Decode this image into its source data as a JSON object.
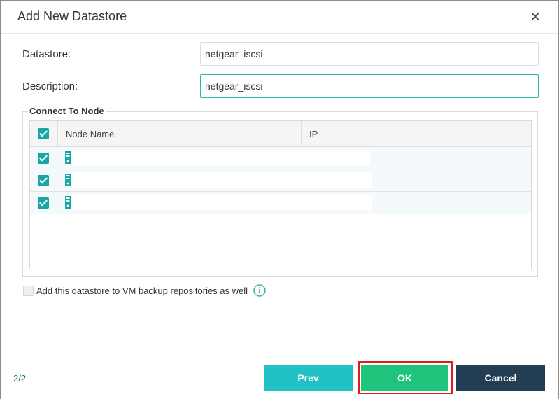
{
  "dialog": {
    "title": "Add New Datastore"
  },
  "form": {
    "datastore_label": "Datastore:",
    "datastore_value": "netgear_iscsi",
    "description_label": "Description:",
    "description_value": "netgear_iscsi"
  },
  "nodes": {
    "legend": "Connect To Node",
    "columns": [
      "Node Name",
      "IP"
    ],
    "rows": [
      {
        "checked": true,
        "name": "",
        "ip": ""
      },
      {
        "checked": true,
        "name": "",
        "ip": ""
      },
      {
        "checked": true,
        "name": "",
        "ip": ""
      }
    ]
  },
  "options": {
    "backup_label": "Add this datastore to VM backup repositories as well",
    "backup_checked": false
  },
  "footer": {
    "step": "2/2",
    "prev_label": "Prev",
    "ok_label": "OK",
    "cancel_label": "Cancel"
  },
  "colors": {
    "accent_teal": "#1aa6a3",
    "prev_button": "#21c1c6",
    "ok_button": "#1ec47b",
    "cancel_button": "#233d52",
    "highlight": "#e01b1b"
  },
  "icons": {
    "close": "close-icon",
    "node": "server-node-icon",
    "info": "info-icon"
  }
}
